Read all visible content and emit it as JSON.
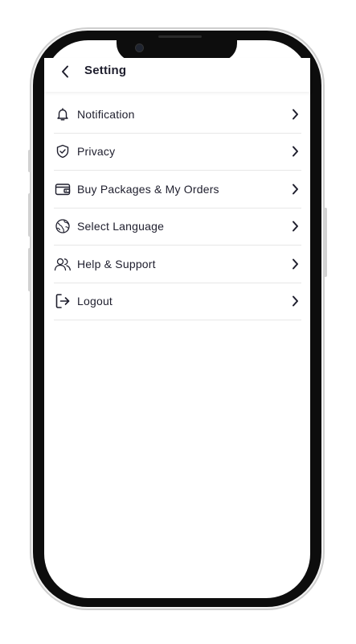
{
  "header": {
    "title": "Setting",
    "back_icon": "chevron-left-icon"
  },
  "menu": {
    "items": [
      {
        "label": "Notification",
        "icon": "bell-icon"
      },
      {
        "label": "Privacy",
        "icon": "shield-check-icon"
      },
      {
        "label": "Buy Packages & My Orders",
        "icon": "wallet-icon"
      },
      {
        "label": "Select Language",
        "icon": "globe-icon"
      },
      {
        "label": "Help & Support",
        "icon": "users-icon"
      },
      {
        "label": "Logout",
        "icon": "logout-icon"
      }
    ]
  },
  "colors": {
    "text": "#1e1e2d",
    "divider": "#e7e7e7",
    "frame": "#0d0d0d",
    "background": "#ffffff"
  }
}
